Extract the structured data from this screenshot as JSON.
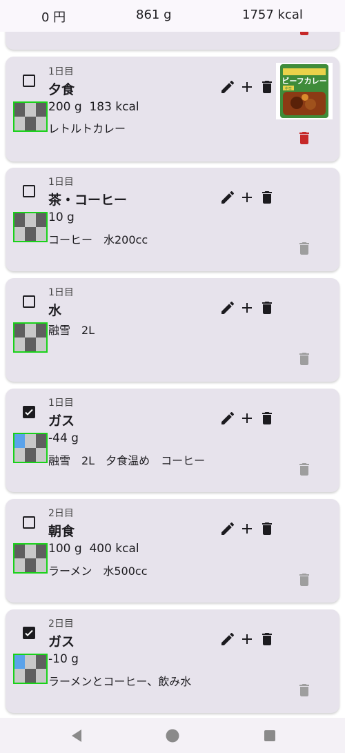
{
  "summary": {
    "cost": "0 円",
    "weight": "861 g",
    "energy": "1757 kcal"
  },
  "cards": [
    {
      "checked": false,
      "day": "1日目",
      "title": "夕食",
      "line1": "200 g  183 kcal",
      "line2": "レトルトカレー",
      "has_photo": true,
      "photo_label": "ビーフカレー",
      "photo_tag": "中辛",
      "delete_color": "#c62828"
    },
    {
      "checked": false,
      "day": "1日目",
      "title": "茶・コーヒー",
      "line1": "10 g",
      "line2": "コーヒー　水200cc",
      "delete_color": "#9e9e9e"
    },
    {
      "checked": false,
      "day": "1日目",
      "title": "水",
      "line1": "",
      "line2": "融雪　2L",
      "delete_color": "#9e9e9e"
    },
    {
      "checked": true,
      "day": "1日目",
      "title": "ガス",
      "line1": "-44 g",
      "line2": "融雪　2L　夕食温め　コーヒー",
      "delete_color": "#9e9e9e"
    },
    {
      "checked": false,
      "day": "2日目",
      "title": "朝食",
      "line1": "100 g  400 kcal",
      "line2": "ラーメン　水500cc",
      "delete_color": "#9e9e9e"
    },
    {
      "checked": true,
      "day": "2日目",
      "title": "ガス",
      "line1": "-10 g",
      "line2": "ラーメンとコーヒー、飲み水",
      "delete_color": "#9e9e9e"
    }
  ],
  "icons": {
    "edit": "pencil-icon",
    "add": "plus-icon",
    "delete": "trash-icon",
    "back": "back-triangle-icon",
    "home": "home-circle-icon",
    "recents": "recents-square-icon"
  },
  "colors": {
    "card_bg": "#e7e3ec",
    "thumb_border": "#19d219",
    "delete_active": "#c62828",
    "delete_inactive": "#9e9e9e"
  }
}
